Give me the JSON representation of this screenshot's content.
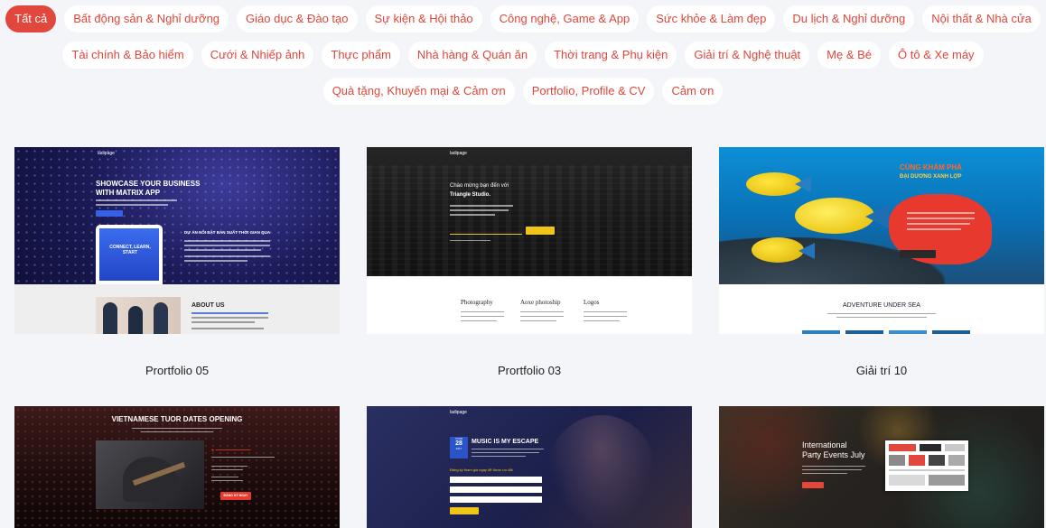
{
  "filters": {
    "row1": [
      "Tất cả",
      "Bất động sản & Nghỉ dưỡng",
      "Giáo dục & Đào tạo",
      "Sự kiện & Hội thảo",
      "Công nghệ, Game & App",
      "Sức khỏe & Làm đẹp",
      "Du lịch & Nghỉ dưỡng",
      "Nội thất & Nhà cửa"
    ],
    "row2": [
      "Tài chính & Bảo hiểm",
      "Cưới & Nhiếp ảnh",
      "Thực phẩm",
      "Nhà hàng & Quán ăn",
      "Thời trang & Phụ kiện",
      "Giải trí & Nghệ thuật",
      "Mẹ & Bé",
      "Ô tô & Xe máy"
    ],
    "row3": [
      "Quà tặng, Khuyến mại & Cảm ơn",
      "Portfolio, Profile & CV",
      "Cảm ơn"
    ],
    "active_index": 0
  },
  "colors": {
    "accent": "#e2473d",
    "background": "#f4f5f9"
  },
  "templates": [
    {
      "name": "Prortfolio 05",
      "thumb": {
        "brand": "ladipage",
        "headline_1": "SHOWCASE YOUR BUSINESS",
        "headline_2": "WITH MATRIX APP",
        "phone_text": "CONNECT, LEARN, START",
        "section_title": "DỰ ÁN NỔI BẬT BẢN SUẤT THỜI GIAN QUA",
        "about_title": "ABOUT US"
      }
    },
    {
      "name": "Prortfolio 03",
      "thumb": {
        "brand": "ladipage",
        "headline_1": "Chào mừng bạn đến với",
        "headline_2": "Triangle Studio.",
        "services": [
          "Photography",
          "Aoxe photoship",
          "Logos"
        ]
      }
    },
    {
      "name": "Giải trí 10",
      "thumb": {
        "headline_1": "CÙNG KHÁM PHÁ",
        "headline_2": "ĐẠI DƯƠNG XANH LỢP",
        "section_title": "ADVENTURE UNDER SEA"
      }
    },
    {
      "name": "",
      "thumb": {
        "headline_1": "VIETNAMESE TUOR DATES OPENING",
        "button": "ĐĂNG KÝ NGAY"
      }
    },
    {
      "name": "",
      "thumb": {
        "brand": "ladipage",
        "date_month": "YOUR",
        "date_day": "28",
        "date_year": "2017",
        "headline_1": "MUSIC IS MY ESCAPE",
        "form_title": "Đăng ký tham gia ngay để được ưu đãi"
      }
    },
    {
      "name": "",
      "thumb": {
        "headline_1": "International",
        "headline_2": "Party Events July"
      }
    }
  ]
}
